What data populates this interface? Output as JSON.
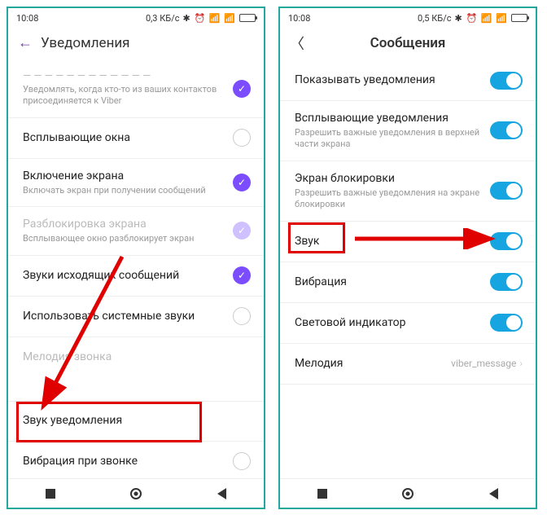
{
  "left": {
    "status": {
      "time": "10:08",
      "net": "0,3 КБ/с"
    },
    "header": {
      "title": "Уведомления"
    },
    "items": [
      {
        "title_trunc": "",
        "sub": "Уведомлять, когда кто-то из ваших контактов присоединяется к Viber",
        "check": "on"
      },
      {
        "title": "Всплывающие окна",
        "check": "off"
      },
      {
        "title": "Включение экрана",
        "sub": "Включать экран при получении сообщений",
        "check": "on"
      },
      {
        "title": "Разблокировка экрана",
        "sub": "Всплывающее окно разблокирует экран",
        "check": "dim",
        "disabled": true
      },
      {
        "title": "Звуки исходящих сообщений",
        "check": "on"
      },
      {
        "title": "Использовать системные звуки",
        "check": "off"
      },
      {
        "title": "Мелодия звонка",
        "disabled": true
      },
      {
        "title": "Звук уведомления"
      },
      {
        "title": "Вибрация при звонке",
        "check": "off"
      }
    ]
  },
  "right": {
    "status": {
      "time": "10:08",
      "net": "0,5 КБ/с"
    },
    "header": {
      "title": "Сообщения"
    },
    "items": [
      {
        "title": "Показывать уведомления",
        "toggle": true
      },
      {
        "title": "Всплывающие уведомления",
        "sub": "Разрешить важные уведомления в верхней части экрана",
        "toggle": true
      },
      {
        "title": "Экран блокировки",
        "sub": "Разрешить важные уведомления на экране блокировки",
        "toggle": true
      },
      {
        "title": "Звук",
        "toggle": true
      },
      {
        "title": "Вибрация",
        "toggle": true
      },
      {
        "title": "Световой индикатор",
        "toggle": true
      },
      {
        "title": "Мелодия",
        "value": "viber_message"
      }
    ]
  }
}
